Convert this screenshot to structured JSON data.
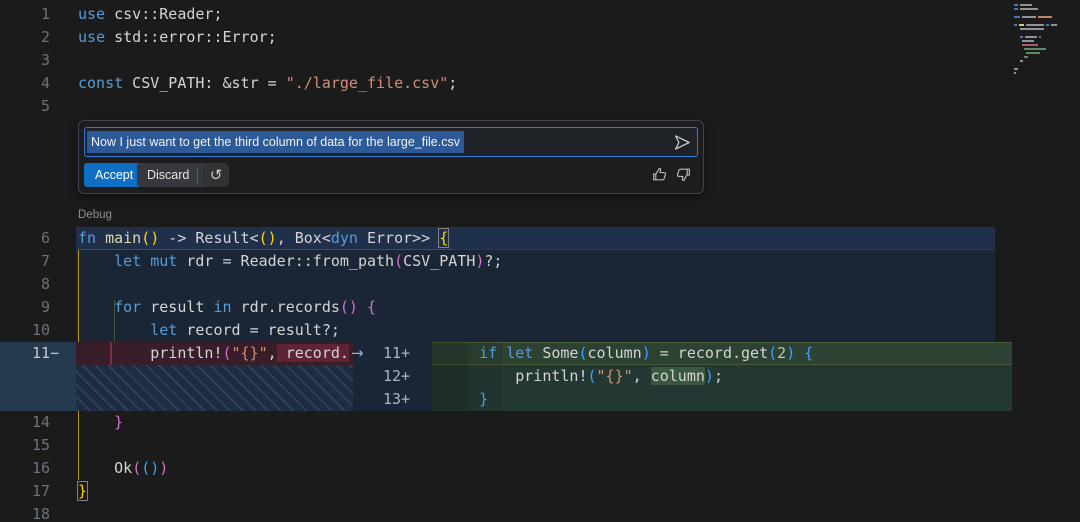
{
  "codelens": {
    "label": "Debug"
  },
  "chat": {
    "input_value": "Now I just want to get the third column of data for the large_file.csv",
    "accept_label": "Accept",
    "discard_label": "Discard",
    "rerun_glyph": "↺"
  },
  "code": {
    "lines_top": [
      {
        "n": "1",
        "t": [
          [
            "kw",
            "use"
          ],
          [
            "fg",
            " csv::Reader;"
          ]
        ]
      },
      {
        "n": "2",
        "t": [
          [
            "kw",
            "use"
          ],
          [
            "fg",
            " std::error::Error;"
          ]
        ]
      },
      {
        "n": "3",
        "t": []
      },
      {
        "n": "4",
        "t": [
          [
            "kw",
            "const"
          ],
          [
            "fg",
            " CSV_PATH: &str = "
          ],
          [
            "str",
            "\"./large_file.csv\""
          ],
          [
            "fg",
            ";"
          ]
        ]
      },
      {
        "n": "5",
        "t": []
      }
    ],
    "lines_mid": [
      {
        "n": "6",
        "t": [
          [
            "kw",
            "fn"
          ],
          [
            "fg",
            " "
          ],
          [
            "fn",
            "main"
          ],
          [
            "b1",
            "()"
          ],
          [
            "fg",
            " -> Result<"
          ],
          [
            "b1",
            "()"
          ],
          [
            "fg",
            ", Box<"
          ],
          [
            "kw",
            "dyn"
          ],
          [
            "fg",
            " Error>> "
          ],
          [
            "b1m",
            "{"
          ]
        ]
      },
      {
        "n": "7",
        "t": [
          [
            "fg",
            "    "
          ],
          [
            "kw",
            "let"
          ],
          [
            "fg",
            " "
          ],
          [
            "kw",
            "mut"
          ],
          [
            "fg",
            " rdr = Reader::from_path"
          ],
          [
            "b2",
            "("
          ],
          [
            "fg",
            "CSV_PATH"
          ],
          [
            "b2",
            ")"
          ],
          [
            "fg",
            "?;"
          ]
        ]
      },
      {
        "n": "8",
        "t": []
      },
      {
        "n": "9",
        "t": [
          [
            "fg",
            "    "
          ],
          [
            "kw",
            "for"
          ],
          [
            "fg",
            " result "
          ],
          [
            "kw",
            "in"
          ],
          [
            "fg",
            " rdr.records"
          ],
          [
            "b2",
            "()"
          ],
          [
            "fg",
            " "
          ],
          [
            "b2",
            "{"
          ]
        ]
      },
      {
        "n": "10",
        "t": [
          [
            "fg",
            "        "
          ],
          [
            "kw",
            "let"
          ],
          [
            "fg",
            " record = result?;"
          ]
        ]
      }
    ],
    "lines_bottom": [
      {
        "n": "14",
        "t": [
          [
            "fg",
            "    "
          ],
          [
            "b2",
            "}"
          ]
        ]
      },
      {
        "n": "15",
        "t": []
      },
      {
        "n": "16",
        "t": [
          [
            "fg",
            "    Ok"
          ],
          [
            "b2",
            "("
          ],
          [
            "b3",
            "()"
          ],
          [
            "b2",
            ")"
          ]
        ]
      },
      {
        "n": "17",
        "t": [
          [
            "b1m",
            "}"
          ]
        ]
      },
      {
        "n": "18",
        "t": []
      }
    ]
  },
  "diff": {
    "arrow_glyph": "→",
    "removed": {
      "n": "11−",
      "t": [
        [
          "fg",
          "        println!"
        ],
        [
          "b2",
          "("
        ],
        [
          "str",
          "\"{}\""
        ],
        [
          "fg",
          ","
        ],
        [
          "delhl",
          " record."
        ]
      ]
    },
    "added": [
      {
        "n": "11+",
        "t": [
          [
            "fg",
            "    "
          ],
          [
            "kw",
            "if"
          ],
          [
            "fg",
            " "
          ],
          [
            "kw",
            "let"
          ],
          [
            "fg",
            " Some"
          ],
          [
            "b3",
            "("
          ],
          [
            "fg",
            "column"
          ],
          [
            "b3",
            ")"
          ],
          [
            "fg",
            " = record.get"
          ],
          [
            "b3",
            "("
          ],
          [
            "num",
            "2"
          ],
          [
            "b3",
            ")"
          ],
          [
            "fg",
            " "
          ],
          [
            "b3",
            "{"
          ]
        ]
      },
      {
        "n": "12+",
        "t": [
          [
            "fg",
            "        println!"
          ],
          [
            "b3",
            "("
          ],
          [
            "str",
            "\"{}\""
          ],
          [
            "fg",
            ", "
          ],
          [
            "addhl",
            "column"
          ],
          [
            "b3",
            ")"
          ],
          [
            "fg",
            ";"
          ]
        ]
      },
      {
        "n": "13+",
        "t": [
          [
            "fg",
            "    "
          ],
          [
            "b3",
            "}"
          ]
        ]
      }
    ]
  },
  "minimap": {
    "palette": {
      "b": "#4d79a8",
      "w": "#8f9499",
      "o": "#c08868",
      "y": "#cfcf7a",
      "g": "#5f8a6a",
      "r": "#a85a66",
      "s": "rgba(0,0,0,0)"
    },
    "rows": [
      [
        [
          "b",
          4
        ],
        [
          "w",
          12
        ]
      ],
      [
        [
          "b",
          4
        ],
        [
          "w",
          18
        ]
      ],
      [],
      [
        [
          "b",
          6
        ],
        [
          "w",
          14
        ],
        [
          "o",
          14
        ]
      ],
      [],
      [
        [
          "b",
          3
        ],
        [
          "y",
          5
        ],
        [
          "w",
          18
        ],
        [
          "b",
          3
        ],
        [
          "w",
          6
        ]
      ],
      [
        [
          "s",
          4
        ],
        [
          "w",
          24
        ]
      ],
      [],
      [
        [
          "s",
          4
        ],
        [
          "b",
          3
        ],
        [
          "w",
          12
        ],
        [
          "b",
          2
        ]
      ],
      [
        [
          "s",
          6
        ],
        [
          "w",
          12
        ]
      ],
      [
        [
          "s",
          6
        ],
        [
          "r",
          16
        ]
      ],
      [
        [
          "s",
          8
        ],
        [
          "g",
          22
        ]
      ],
      [
        [
          "s",
          10
        ],
        [
          "g",
          14
        ]
      ],
      [
        [
          "s",
          8
        ],
        [
          "g",
          4
        ]
      ],
      [
        [
          "s",
          4
        ],
        [
          "w",
          3
        ]
      ],
      [],
      [
        [
          "w",
          4
        ]
      ],
      [
        [
          "w",
          2
        ]
      ]
    ]
  }
}
